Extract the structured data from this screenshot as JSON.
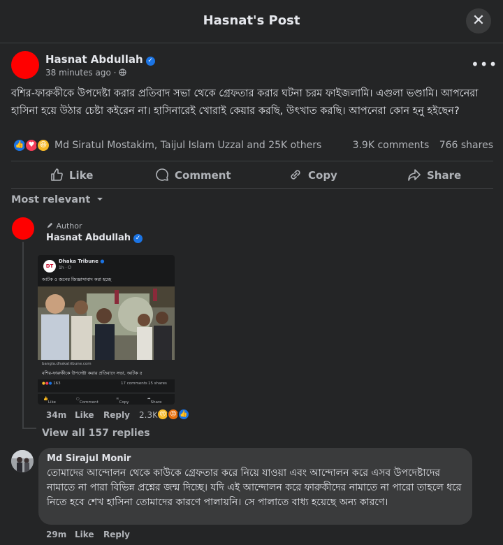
{
  "header": {
    "title": "Hasnat's Post",
    "close_icon": "close-icon"
  },
  "post": {
    "author": "Hasnat Abdullah",
    "verified_icon": "verified-badge-icon",
    "time": "38 minutes ago",
    "audience_icon": "globe-icon",
    "more_icon": "more-dots-icon",
    "text": "বশির-ফারুকীকে উপদেষ্টা করার প্রতিবাদ সভা থেকে গ্রেফতার করার ঘটনা চরম ফাইজলামি। এগুলা ভণ্ডামি। আপনেরা হাসিনা হয়ে উঠার চেষ্টা কইরেন না। হাসিনারেই খোরাই কেয়ার করছি, উৎখাত করছি। আপনেরা কোন হনু হইছেন?",
    "reaction_icons": [
      "like-reaction-icon",
      "love-reaction-icon",
      "haha-reaction-icon"
    ],
    "reacted_by": "Md Siratul Mostakim, Taijul Islam Uzzal and 25K others",
    "comments_count": "3.9K comments",
    "shares_count": "766 shares"
  },
  "actions": {
    "like": "Like",
    "comment": "Comment",
    "copy": "Copy",
    "share": "Share"
  },
  "sort_label": "Most relevant",
  "comment1": {
    "badge": "Author",
    "author": "Hasnat Abdullah",
    "embed": {
      "logo": "DT",
      "page_name": "Dhaka Tribune",
      "time": "1h",
      "caption": "আটক ৫ জনের জিজ্ঞাসাবাদ করা হচ্ছে",
      "link_domain": "bangla.dhakatribune.com",
      "link_title": "বশির-ফারুকীকে উপদেষ্টা করার প্রতিবাদে সভা, আটক ৫",
      "reactions": "163",
      "comments": "17 comments",
      "shares": "15 shares",
      "like": "Like",
      "comment": "Comment",
      "copy": "Copy",
      "share": "Share"
    },
    "time": "34m",
    "like": "Like",
    "reply": "Reply",
    "reaction_count": "2.3K",
    "view_replies": "View all 157 replies"
  },
  "comment2": {
    "author": "Md Sirajul Monir",
    "text": "তোমাদের আন্দোলন থেকে কাউকে গ্রেফতার করে নিয়ে যাওয়া এবং আন্দোলন করে এসব উপদেষ্টাদের নামাতে না পারা বিভিন্ন প্রশ্নের জন্ম দিচ্ছে। যদি এই আন্দোলন করে ফারুকীদের নামাতে না পারো তাহলে ধরে নিতে হবে শেখ হাসিনা তোমাদের কারণে পালায়নি। সে পালাতে বাধ্য হয়েছে অন্য কারণে।",
    "time": "29m",
    "like": "Like",
    "reply": "Reply"
  }
}
